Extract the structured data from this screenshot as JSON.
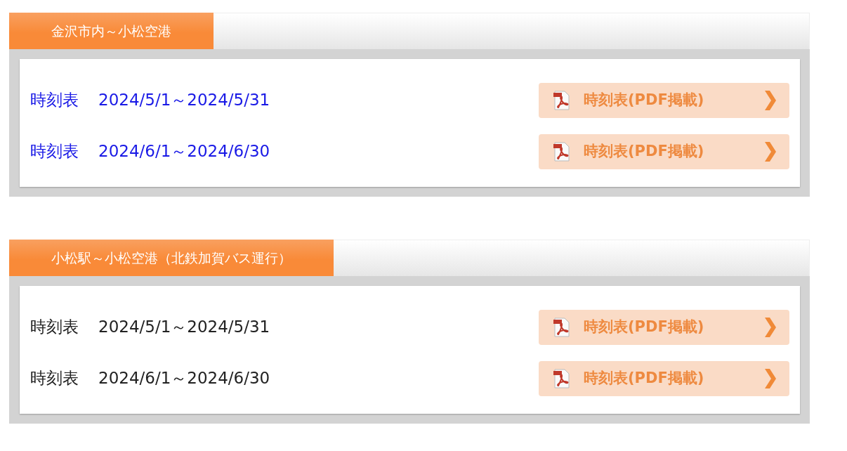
{
  "sections": [
    {
      "title": "金沢市内～小松空港",
      "rows": [
        {
          "label": "時刻表",
          "period": "2024/5/1～2024/5/31",
          "linked": true,
          "button": "時刻表(PDF掲載)"
        },
        {
          "label": "時刻表",
          "period": "2024/6/1～2024/6/30",
          "linked": true,
          "button": "時刻表(PDF掲載)"
        }
      ]
    },
    {
      "title": "小松駅～小松空港（北鉄加賀バス運行）",
      "rows": [
        {
          "label": "時刻表",
          "period": "2024/5/1～2024/5/31",
          "linked": false,
          "button": "時刻表(PDF掲載)"
        },
        {
          "label": "時刻表",
          "period": "2024/6/1～2024/6/30",
          "linked": false,
          "button": "時刻表(PDF掲載)"
        }
      ]
    }
  ]
}
